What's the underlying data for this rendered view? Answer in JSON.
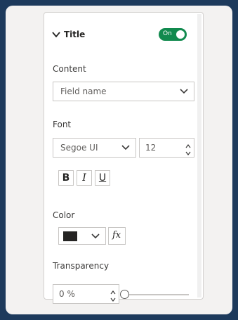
{
  "section": {
    "title": "Title",
    "toggle": {
      "label": "On",
      "state": "on",
      "color": "#118a4e"
    }
  },
  "content": {
    "label": "Content",
    "dropdown": {
      "value": "Field name"
    }
  },
  "font": {
    "label": "Font",
    "family": {
      "value": "Segoe UI"
    },
    "size": {
      "value": "12"
    },
    "bold_label": "B",
    "italic_label": "I",
    "underline_label": "U"
  },
  "color": {
    "label": "Color",
    "swatch": "#252423",
    "fx_label": "fx"
  },
  "transparency": {
    "label": "Transparency",
    "value": "0 %",
    "percent": 0
  },
  "icons": {
    "section": "chevron-down-icon",
    "dropdown": "chevron-down-icon",
    "spin": "spinner-arrows-icon"
  }
}
